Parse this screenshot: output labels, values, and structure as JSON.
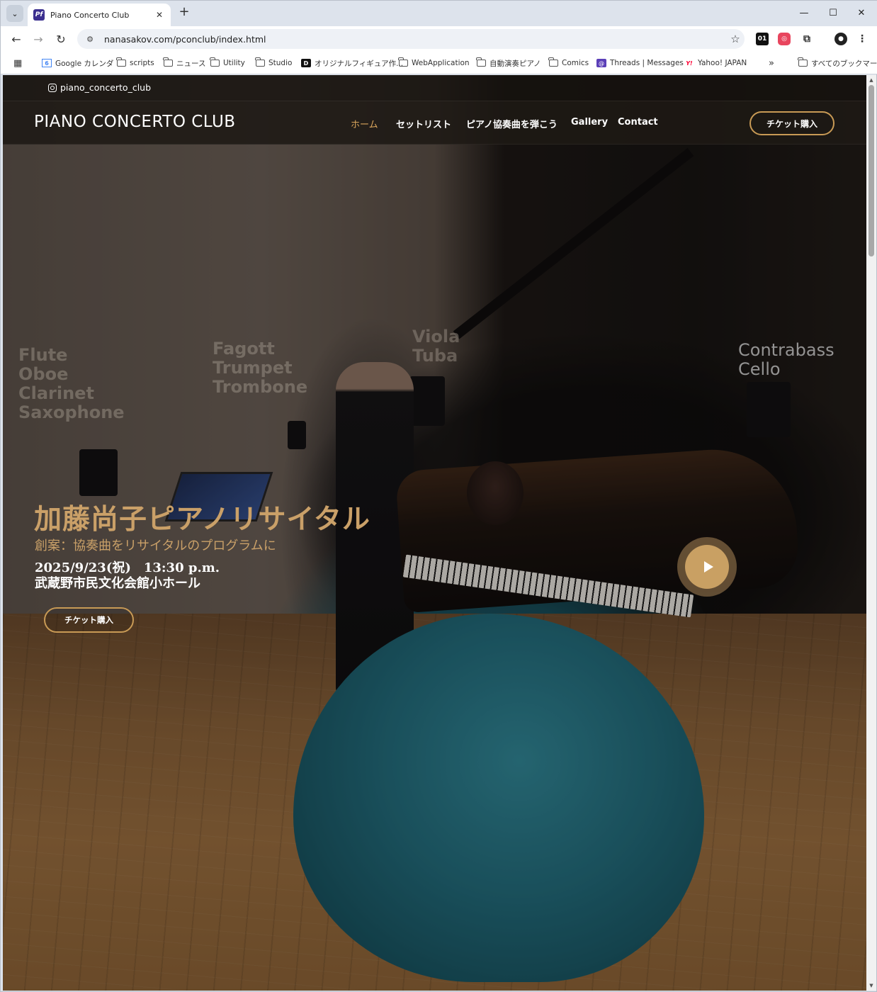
{
  "browser": {
    "tab_title": "Piano Concerto Club",
    "favicon_text": "Pf",
    "tab_close": "✕",
    "new_tab": "+",
    "url": "nanasakov.com/pconclub/index.html",
    "window_controls": {
      "minimize": "—",
      "maximize": "☐",
      "close": "✕"
    }
  },
  "bookmarks": [
    {
      "label": "Google カレンダ",
      "icon": "calendar-icon"
    },
    {
      "label": "scripts",
      "icon": "folder-icon"
    },
    {
      "label": "ニュース",
      "icon": "folder-icon"
    },
    {
      "label": "Utility",
      "icon": "folder-icon"
    },
    {
      "label": "Studio",
      "icon": "folder-icon"
    },
    {
      "label": "オリジナルフィギュア作...",
      "icon": "d-app-icon"
    },
    {
      "label": "WebApplication",
      "icon": "folder-icon"
    },
    {
      "label": "自動演奏ピアノ",
      "icon": "folder-icon"
    },
    {
      "label": "Comics",
      "icon": "folder-icon"
    },
    {
      "label": "Threads | Messages",
      "icon": "threads-icon"
    },
    {
      "label": "Yahoo! JAPAN",
      "icon": "yahoo-icon"
    },
    {
      "label": "すべてのブックマーク",
      "icon": "folder-icon"
    }
  ],
  "bookmarks_overflow": "»",
  "site": {
    "instagram": "piano_concerto_club",
    "logo": "PIANO CONCERTO CLUB",
    "nav": [
      "ホーム",
      "セットリスト",
      "ピアノ協奏曲を弾こう",
      "Gallery",
      "Contact"
    ],
    "nav_cta": "チケット購入"
  },
  "hero": {
    "title": "加藤尚子ピアノリサイタル",
    "subtitle": "創案：協奏曲をリサイタルのプログラムに",
    "date": "2025/9/23(祝)　13:30 p.m.",
    "venue": "武蔵野市民文化会館小ホール",
    "cta": "チケット購入",
    "instrument_labels": {
      "left": "Flute\nOboe\nClarinet\nSaxophone",
      "center_left": "Fagott\nTrumpet\nTrombone",
      "center": "Viola\nTuba",
      "right": "Contrabass\nCello"
    }
  },
  "colors": {
    "accent_gold": "#c9a068",
    "nav_bg": "#1e1915",
    "dress_teal": "#1f6a7a"
  }
}
